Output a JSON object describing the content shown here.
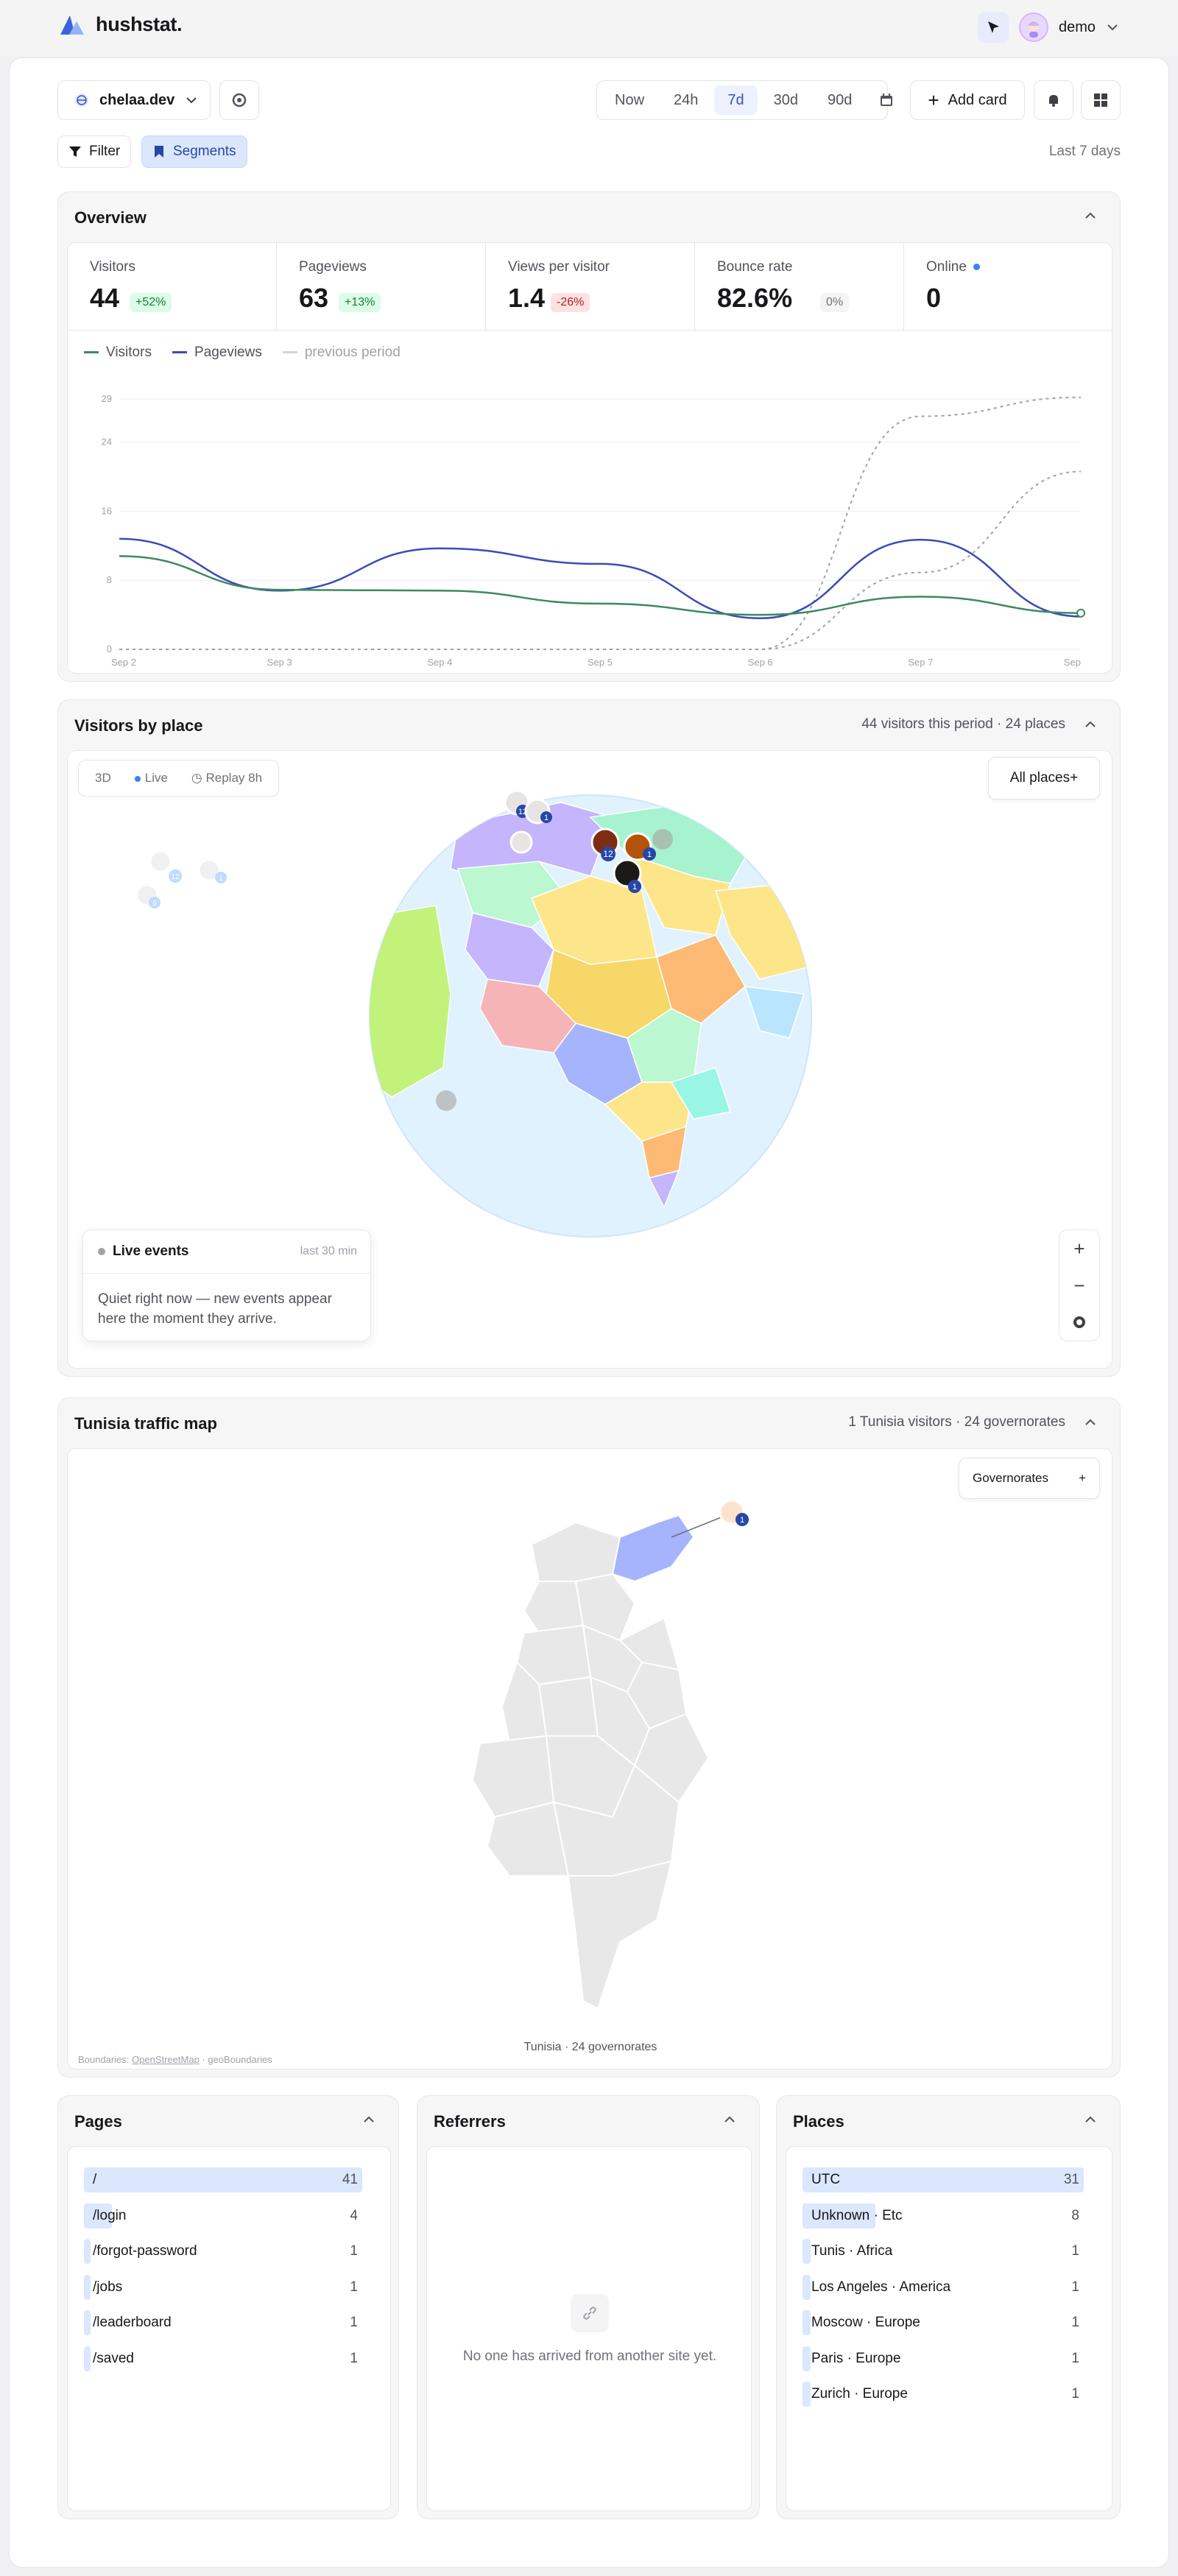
{
  "app": {
    "name": "hushstat."
  },
  "user": {
    "name": "demo"
  },
  "toolbar": {
    "site": "chelaa.dev",
    "ranges": [
      "Now",
      "24h",
      "7d",
      "30d",
      "90d"
    ],
    "active_range": "7d",
    "add_card": "Add card",
    "filter": "Filter",
    "segments": "Segments",
    "period_label": "Last 7 days"
  },
  "overview": {
    "title": "Overview",
    "stats": [
      {
        "label": "Visitors",
        "value": "44",
        "delta": "+52%",
        "tone": "up"
      },
      {
        "label": "Pageviews",
        "value": "63",
        "delta": "+13%",
        "tone": "up"
      },
      {
        "label": "Views per visitor",
        "value": "1.4",
        "delta": "-26%",
        "tone": "down"
      },
      {
        "label": "Bounce rate",
        "value": "82.6%",
        "delta": "0%",
        "tone": "flat"
      },
      {
        "label": "Online",
        "value": "0",
        "delta": "",
        "tone": "online"
      }
    ],
    "legend": [
      "Visitors",
      "Pageviews",
      "previous period"
    ]
  },
  "chart_data": {
    "type": "line",
    "x": [
      "Sep 2",
      "Sep 3",
      "Sep 4",
      "Sep 5",
      "Sep 6",
      "Sep 7",
      "Sep"
    ],
    "yticks": [
      0,
      8,
      16,
      24,
      29
    ],
    "ylim": [
      0,
      29
    ],
    "series": [
      {
        "name": "Visitors",
        "color": "#3d8a5f",
        "style": "solid",
        "values": [
          10.8,
          6.9,
          6.8,
          5.3,
          4.0,
          6.1,
          4.2
        ]
      },
      {
        "name": "Pageviews",
        "color": "#3a4cb8",
        "style": "solid",
        "values": [
          12.8,
          6.8,
          11.7,
          9.9,
          3.6,
          12.7,
          3.8
        ]
      },
      {
        "name": "previous period",
        "color": "#a1a1aa",
        "style": "dashed",
        "values": [
          0,
          0,
          0,
          0,
          0,
          27.0,
          29.2
        ]
      },
      {
        "name": "previous period",
        "color": "#a1a1aa",
        "style": "dashed",
        "values": [
          0,
          0,
          0,
          0,
          0,
          8.9,
          20.6
        ]
      }
    ]
  },
  "places_card": {
    "title": "Visitors by place",
    "summary": "44 visitors this period · 24 places",
    "modes": [
      "3D",
      "Live",
      "Replay 8h"
    ],
    "all_places": "All places+",
    "live_title": "Live events",
    "live_window": "last 30 min",
    "live_empty": "Quiet right now — new events appear here the moment they arrive.",
    "markers": [
      "12",
      "1",
      "1",
      "12",
      "1",
      "6"
    ]
  },
  "tunisia_card": {
    "title": "Tunisia traffic map",
    "summary": "1 Tunisia visitors · 24 governorates",
    "button": "Governorates",
    "button_icon": "+",
    "caption": "Tunisia · 24 governorates",
    "attribution_prefix": "Boundaries:",
    "attribution_link": "OpenStreetMap",
    "attribution_suffix": "· geoBoundaries",
    "marker": "1"
  },
  "pages": {
    "title": "Pages",
    "rows": [
      {
        "label": "/",
        "count": "41",
        "share": 1.0
      },
      {
        "label": "/login",
        "count": "4",
        "share": 0.1
      },
      {
        "label": "/forgot-password",
        "count": "1",
        "share": 0.02
      },
      {
        "label": "/jobs",
        "count": "1",
        "share": 0.02
      },
      {
        "label": "/leaderboard",
        "count": "1",
        "share": 0.02
      },
      {
        "label": "/saved",
        "count": "1",
        "share": 0.02
      }
    ]
  },
  "referrers": {
    "title": "Referrers",
    "empty": "No one has arrived from another site yet."
  },
  "places": {
    "title": "Places",
    "rows": [
      {
        "label": "UTC",
        "count": "31",
        "share": 1.0
      },
      {
        "label": "Unknown · Etc",
        "count": "8",
        "share": 0.26
      },
      {
        "label": "Tunis · Africa",
        "count": "1",
        "share": 0.03
      },
      {
        "label": "Los Angeles · America",
        "count": "1",
        "share": 0.03
      },
      {
        "label": "Moscow · Europe",
        "count": "1",
        "share": 0.03
      },
      {
        "label": "Paris · Europe",
        "count": "1",
        "share": 0.03
      },
      {
        "label": "Zurich · Europe",
        "count": "1",
        "share": 0.03
      }
    ]
  }
}
